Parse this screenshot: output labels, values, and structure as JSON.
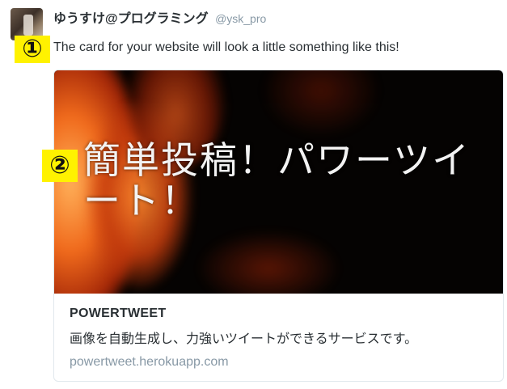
{
  "tweet": {
    "display_name": "ゆうすけ@プログラミング",
    "screen_name": "@ysk_pro",
    "text": "The card for your website will look a little something like this!"
  },
  "markers": {
    "first": "①",
    "second": "②"
  },
  "card": {
    "image_title": "簡単投稿！パワーツイート！",
    "title": "POWERTWEET",
    "description": "画像を自動生成し、力強いツイートができるサービスです。",
    "domain": "powertweet.herokuapp.com"
  }
}
